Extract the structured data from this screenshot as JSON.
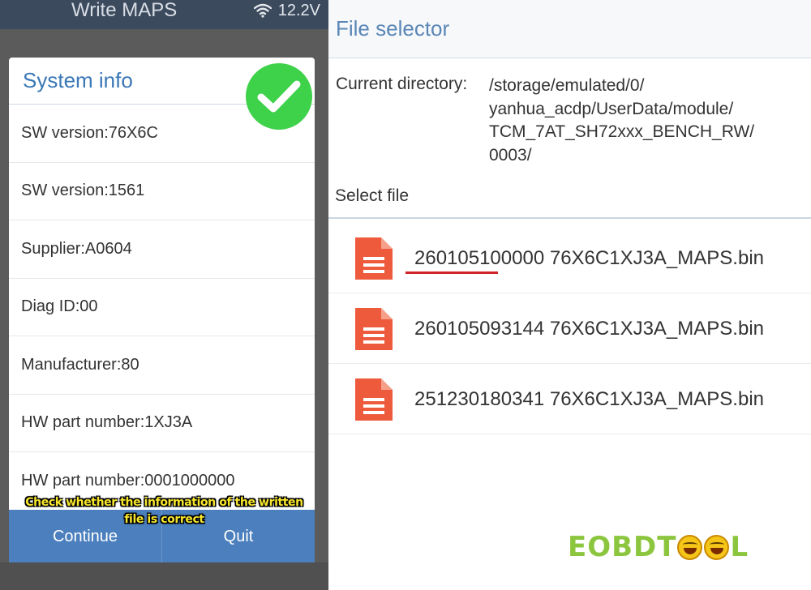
{
  "left_app": {
    "title": "Write MAPS",
    "battery_voltage": "12.2V"
  },
  "system_info": {
    "title": "System info",
    "rows": [
      "SW version:76X6C",
      "SW version:1561",
      "Supplier:A0604",
      "Diag ID:00",
      "Manufacturer:80",
      "HW part number:1XJ3A",
      "HW part number:0001000000"
    ],
    "continue_label": "Continue",
    "quit_label": "Quit"
  },
  "subtitle": {
    "line1": "Check whether the information of the written",
    "line2": "file is correct"
  },
  "file_selector": {
    "title": "File selector",
    "current_directory_label": "Current directory:",
    "current_directory_lines": [
      "/storage/emulated/0/",
      "yanhua_acdp/UserData/module/",
      "TCM_7AT_SH72xxx_BENCH_RW/",
      "0003/"
    ],
    "select_file_label": "Select file",
    "files": [
      "260105100000 76X6C1XJ3A_MAPS.bin",
      "260105093144 76X6C1XJ3A_MAPS.bin",
      "251230180341 76X6C1XJ3A_MAPS.bin"
    ]
  },
  "watermark": {
    "part1": "EOBDT",
    "part2": "L"
  },
  "colors": {
    "accent_blue": "#4b7fbd",
    "check_green": "#3ed14a",
    "file_icon_orange": "#ee5b3c",
    "highlight_red": "#d0242b",
    "subtitle_yellow": "#f7e62c",
    "watermark_green": "#8cc63f"
  }
}
